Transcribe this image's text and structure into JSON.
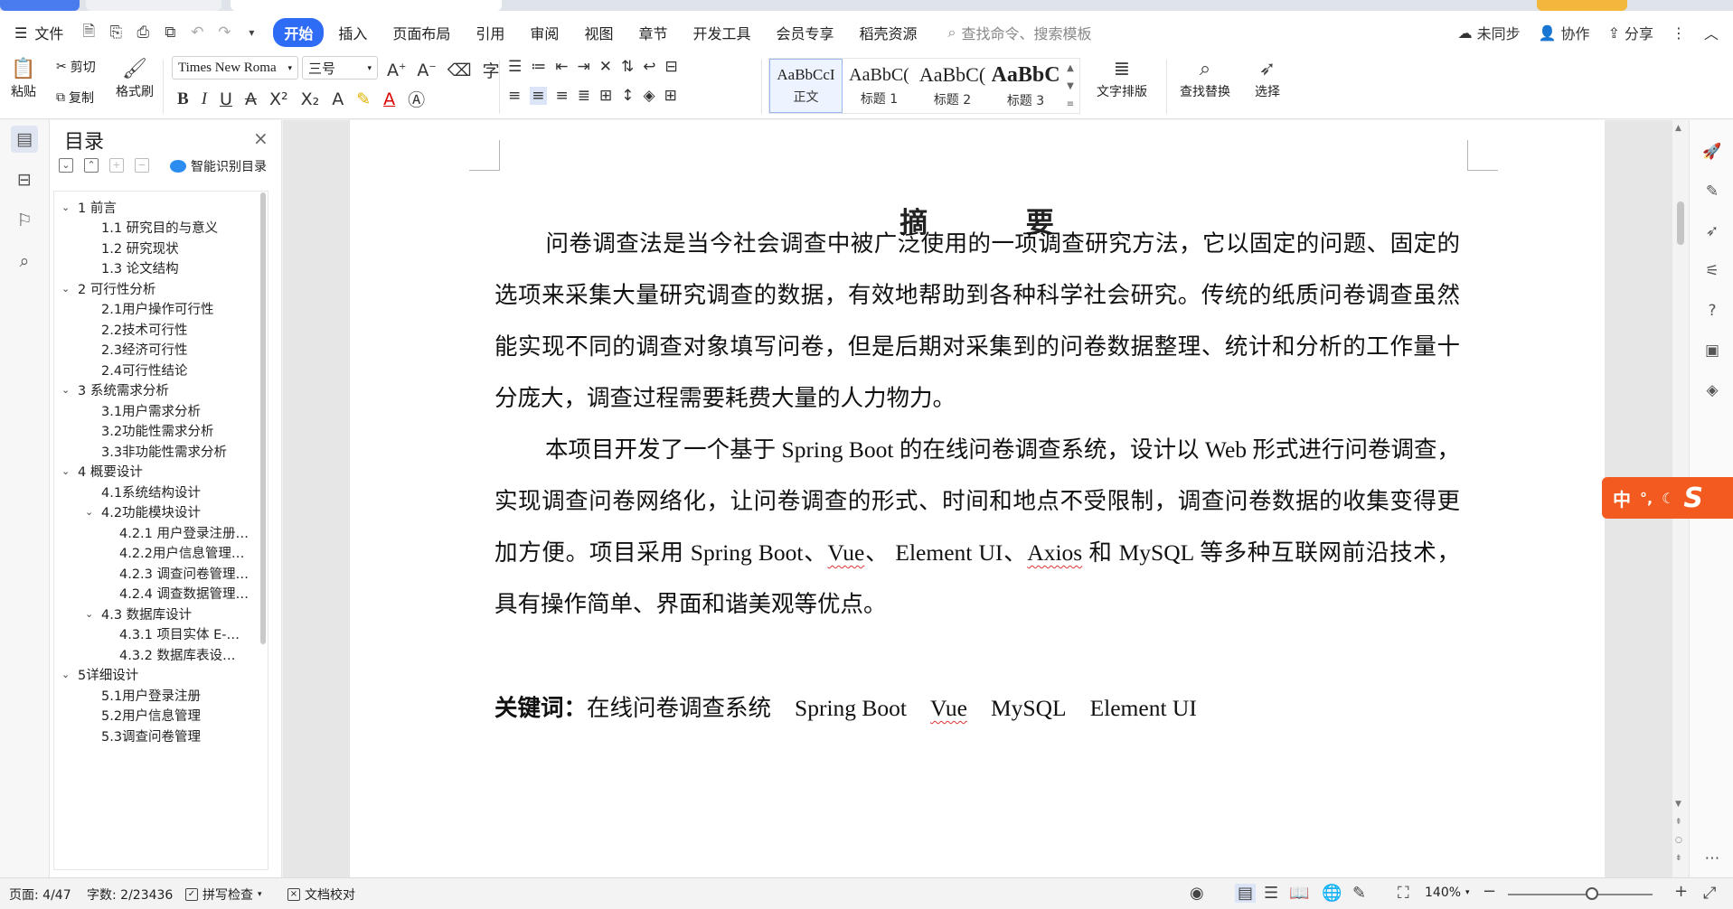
{
  "menubar": {
    "file_label": "文件",
    "items": [
      "开始",
      "插入",
      "页面布局",
      "引用",
      "审阅",
      "视图",
      "章节",
      "开发工具",
      "会员专享",
      "稻壳资源"
    ],
    "active_index": 0,
    "search_placeholder": "查找命令、搜索模板",
    "sync_label": "未同步",
    "collab_label": "协作",
    "share_label": "分享"
  },
  "ribbon": {
    "paste": "粘贴",
    "cut": "剪切",
    "copy": "复制",
    "format_painter": "格式刷",
    "font_name": "Times New Roma",
    "font_size": "三号",
    "styles": [
      {
        "preview": "AaBbCcI",
        "name": "正文"
      },
      {
        "preview": "AaBbC(",
        "name": "标题 1"
      },
      {
        "preview": "AaBbC(",
        "name": "标题 2"
      },
      {
        "preview": "AaBbC",
        "name": "标题 3"
      }
    ],
    "text_layout": "文字排版",
    "find_replace": "查找替换",
    "select": "选择"
  },
  "toc": {
    "title": "目录",
    "smart_toc": "智能识别目录",
    "items": [
      {
        "text": "1   前言",
        "level": 1,
        "chevron": "expanded"
      },
      {
        "text": "1.1   研究目的与意义",
        "level": 2
      },
      {
        "text": "1.2   研究现状",
        "level": 2
      },
      {
        "text": "1.3   论文结构",
        "level": 2
      },
      {
        "text": "2   可行性分析",
        "level": 1,
        "chevron": "expanded"
      },
      {
        "text": "2.1用户操作可行性",
        "level": 2
      },
      {
        "text": "2.2技术可行性",
        "level": 2
      },
      {
        "text": "2.3经济可行性",
        "level": 2
      },
      {
        "text": "2.4可行性结论",
        "level": 2
      },
      {
        "text": "3   系统需求分析",
        "level": 1,
        "chevron": "expanded"
      },
      {
        "text": "3.1用户需求分析",
        "level": 2
      },
      {
        "text": "3.2功能性需求分析",
        "level": 2
      },
      {
        "text": "3.3非功能性需求分析",
        "level": 2
      },
      {
        "text": "4   概要设计",
        "level": 1,
        "chevron": "expanded"
      },
      {
        "text": "4.1系统结构设计",
        "level": 2
      },
      {
        "text": "4.2功能模块设计",
        "level": 2,
        "chevron": "expanded"
      },
      {
        "text": "4.2.1  用户登录注册…",
        "level": 3
      },
      {
        "text": "4.2.2用户信息管理…",
        "level": 3
      },
      {
        "text": "4.2.3  调查问卷管理…",
        "level": 3
      },
      {
        "text": "4.2.4  调查数据管理…",
        "level": 3
      },
      {
        "text": "4.3   数据库设计",
        "level": 2,
        "chevron": "expanded"
      },
      {
        "text": "4.3.1    项目实体 E-…",
        "level": 3
      },
      {
        "text": "4.3.2    数据库表设…",
        "level": 3
      },
      {
        "text": "5详细设计",
        "level": 1,
        "chevron": "expanded"
      },
      {
        "text": "5.1用户登录注册",
        "level": 2
      },
      {
        "text": "5.2用户信息管理",
        "level": 2
      },
      {
        "text": "5.3调查问卷管理",
        "level": 2
      }
    ]
  },
  "document": {
    "heading_left": "摘",
    "heading_right": "要",
    "para1": "问卷调查法是当今社会调查中被广泛使用的一项调查研究方法，它以固定的问题、固定的选项来采集大量研究调查的数据，有效地帮助到各种科学社会研究。传统的纸质问卷调查虽然能实现不同的调查对象填写问卷，但是后期对采集到的问卷数据整理、统计和分析的工作量十分庞大，调查过程需要耗费大量的人力物力。",
    "para2_before_vue": "本项目开发了一个基于 Spring Boot 的在线问卷调查系统，设计以 Web 形式进行问卷调查，实现调查问卷网络化，让问卷调查的形式、时间和地点不受限制，调查问卷数据的收集变得更加方便。项目采用 Spring Boot、",
    "vue": "Vue",
    "para2_mid": "、 Element UI、",
    "axios": "Axios",
    "para2_end": " 和 MySQL 等多种互联网前沿技术，具有操作简单、界面和谐美观等优点。",
    "keywords_label": "关键词：",
    "keywords": [
      "在线问卷调查系统",
      "Spring Boot",
      "Vue",
      "MySQL",
      "Element UI"
    ]
  },
  "ime": {
    "lang": "中",
    "punct": "°,"
  },
  "statusbar": {
    "page": "页面: 4/47",
    "words": "字数: 2/23436",
    "spellcheck": "拼写检查",
    "doc_check": "文档校对",
    "zoom": "140%"
  },
  "colors": {
    "accent": "#2f6cf6",
    "ime": "#f25a1f",
    "squiggle": "#d33"
  }
}
